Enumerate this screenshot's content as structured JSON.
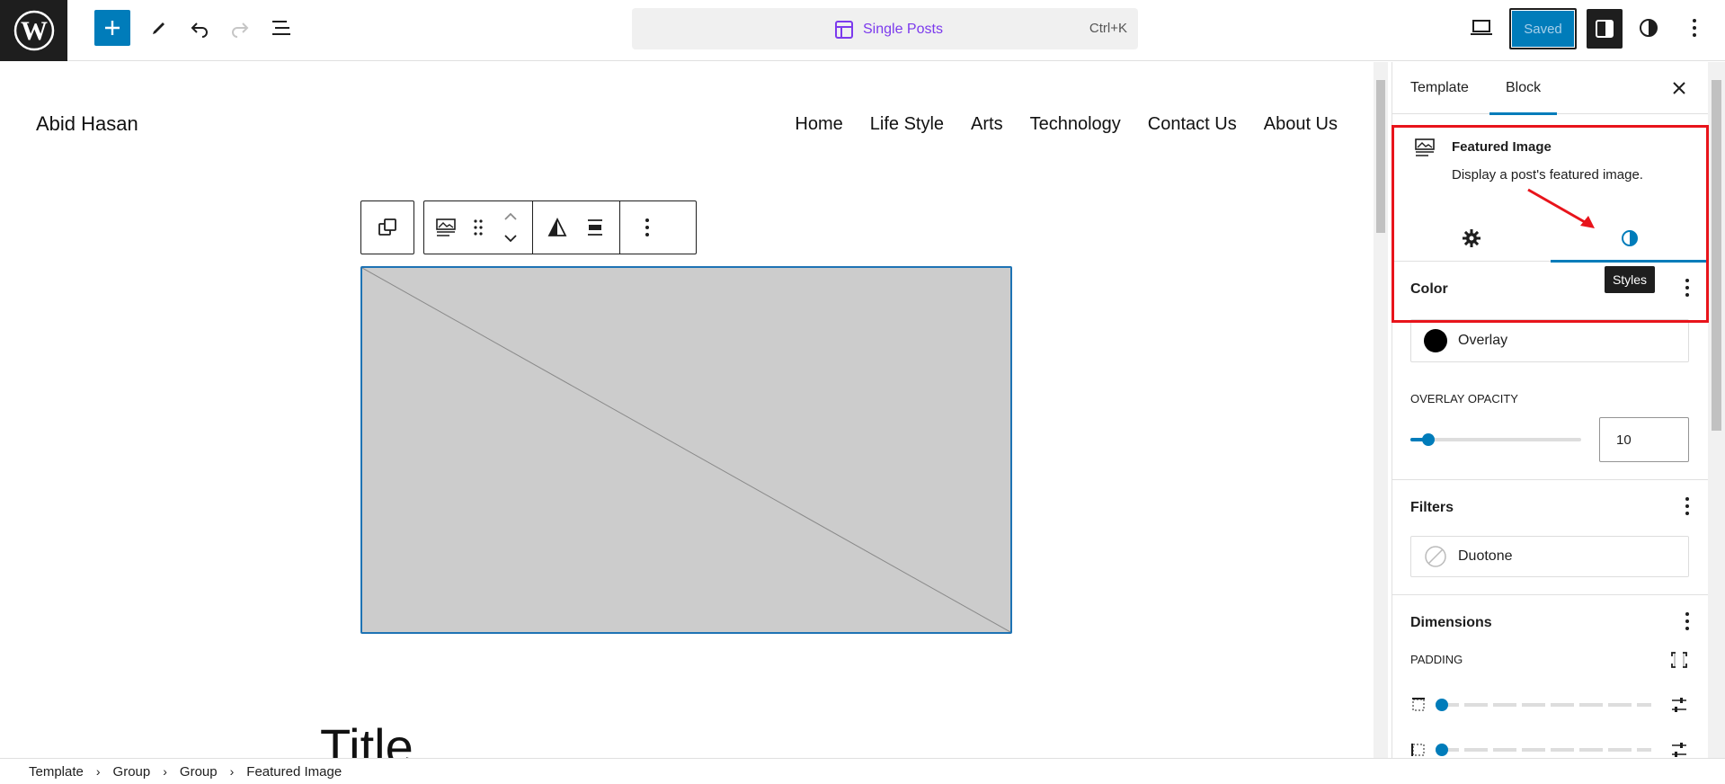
{
  "header": {
    "add_icon": "plus-icon",
    "tools": [
      "pen-icon",
      "undo-icon",
      "redo-icon",
      "list-view-icon"
    ],
    "command": {
      "title": "Single Posts",
      "shortcut": "Ctrl+K",
      "icon": "template-layout-icon"
    },
    "view_icon": "desktop-view-icon",
    "saved_label": "Saved",
    "more_icon": "vertical-ellipsis-icon"
  },
  "site": {
    "title": "Abid Hasan",
    "nav": [
      "Home",
      "Life Style",
      "Arts",
      "Technology",
      "Contact Us",
      "About Us"
    ]
  },
  "post": {
    "title": "Title"
  },
  "breadcrumb": [
    "Template",
    "Group",
    "Group",
    "Featured Image"
  ],
  "sidebar": {
    "tabs": {
      "template": "Template",
      "block": "Block"
    },
    "block": {
      "name": "Featured Image",
      "description": "Display a post's featured image."
    },
    "inspector_tabs": {
      "settings_icon": "gear-icon",
      "styles_icon": "half-circle-icon"
    },
    "tooltip": "Styles",
    "color": {
      "heading": "Color",
      "overlay_label": "Overlay",
      "overlay_color": "#000000",
      "opacity_label": "OVERLAY OPACITY",
      "opacity_value": "10"
    },
    "filters": {
      "heading": "Filters",
      "duotone_label": "Duotone"
    },
    "dimensions": {
      "heading": "Dimensions",
      "padding_label": "PADDING"
    }
  },
  "colors": {
    "accent": "#007cba",
    "annotation": "#e8141b",
    "template_purple": "#7c3aed"
  }
}
